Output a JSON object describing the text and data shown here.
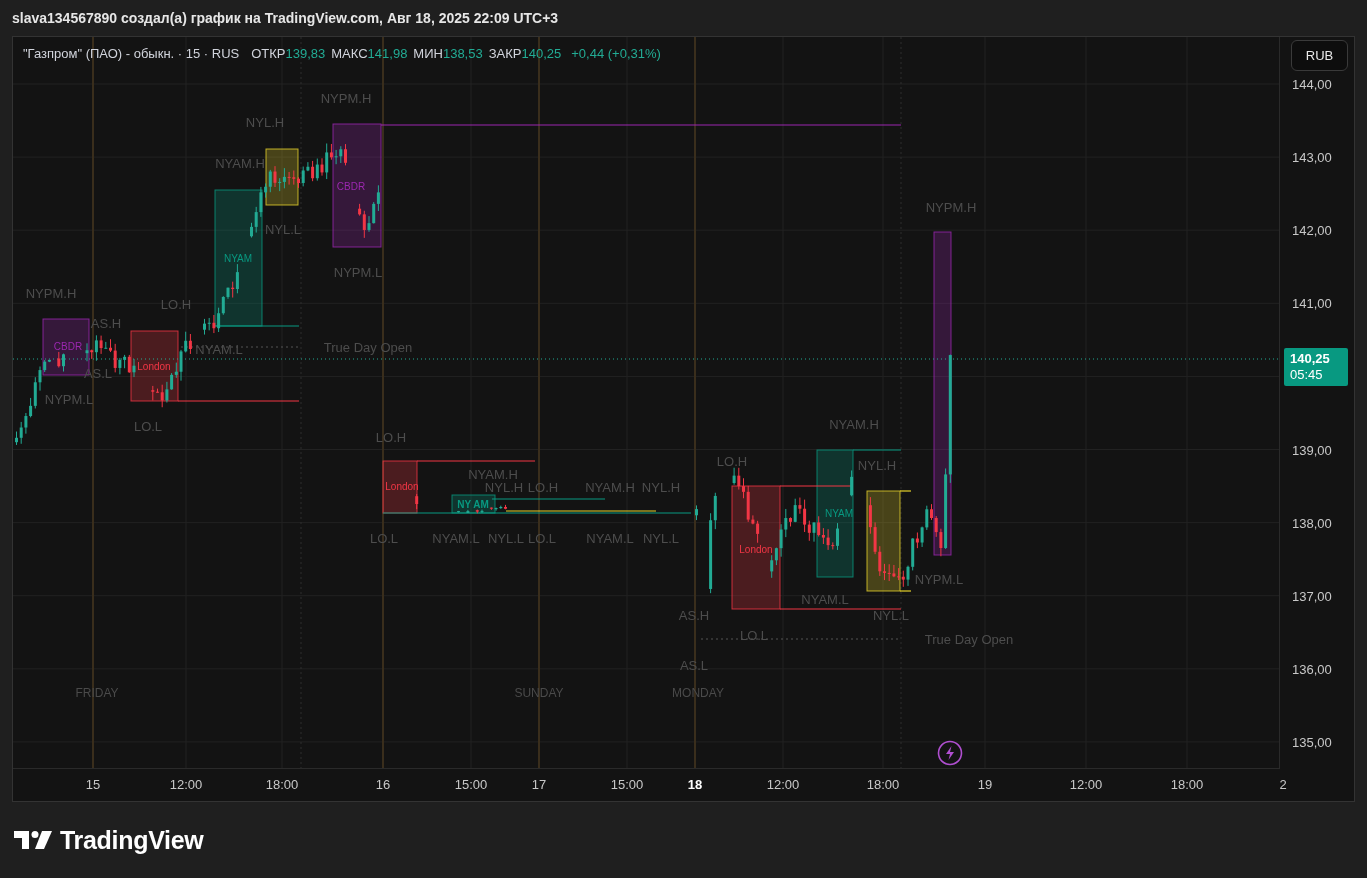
{
  "header": {
    "text": "slava134567890 создал(а) график на TradingView.com, Авг 18, 2025 22:09 UTC+3"
  },
  "legend": {
    "symbol": "\"Газпром\" (ПАО) - обыкн. · 15 · RUS",
    "fields": [
      {
        "label": "ОТКР",
        "value": "139,83"
      },
      {
        "label": "МАКС",
        "value": "141,98"
      },
      {
        "label": "МИН",
        "value": "138,53"
      },
      {
        "label": "ЗАКР",
        "value": "140,25"
      }
    ],
    "change": "+0,44 (+0,31%)"
  },
  "currency_button": "RUB",
  "price_axis": {
    "ticks": [
      "144,00",
      "143,00",
      "142,00",
      "141,00",
      "139,00",
      "138,00",
      "137,00",
      "136,00",
      "135,00"
    ],
    "last_price": "140,25",
    "countdown": "05:45"
  },
  "time_axis": [
    {
      "label": "15",
      "current": false
    },
    {
      "label": "12:00",
      "current": false
    },
    {
      "label": "18:00",
      "current": false
    },
    {
      "label": "16",
      "current": false
    },
    {
      "label": "15:00",
      "current": false
    },
    {
      "label": "17",
      "current": false
    },
    {
      "label": "15:00",
      "current": false
    },
    {
      "label": "18",
      "current": true
    },
    {
      "label": "12:00",
      "current": false
    },
    {
      "label": "18:00",
      "current": false
    },
    {
      "label": "19",
      "current": false
    },
    {
      "label": "12:00",
      "current": false
    },
    {
      "label": "18:00",
      "current": false
    },
    {
      "label": "2",
      "current": false
    }
  ],
  "chart_labels": [
    {
      "text": "NYPM.H",
      "kind": "level"
    },
    {
      "text": "NYL.H",
      "kind": "level"
    },
    {
      "text": "NYAM.H",
      "kind": "level"
    },
    {
      "text": "CBDR",
      "kind": "session",
      "color": "#9c27b0"
    },
    {
      "text": "NYPM.H",
      "kind": "level"
    },
    {
      "text": "NYL.L",
      "kind": "level"
    },
    {
      "text": "NYAM",
      "kind": "session",
      "color": "#089981"
    },
    {
      "text": "NYPM.L",
      "kind": "level"
    },
    {
      "text": "NYPM.H",
      "kind": "level"
    },
    {
      "text": "LO.H",
      "kind": "level"
    },
    {
      "text": "AS.H",
      "kind": "level"
    },
    {
      "text": "CBDR",
      "kind": "session",
      "color": "#9c27b0"
    },
    {
      "text": "NYAM.L",
      "kind": "level"
    },
    {
      "text": "True Day Open",
      "kind": "level"
    },
    {
      "text": "London",
      "kind": "session",
      "color": "#f23645"
    },
    {
      "text": "AS.L",
      "kind": "level"
    },
    {
      "text": "NYPM.L",
      "kind": "level"
    },
    {
      "text": "NYAM.H",
      "kind": "level"
    },
    {
      "text": "LO.L",
      "kind": "level"
    },
    {
      "text": "LO.H",
      "kind": "level"
    },
    {
      "text": "LO.H",
      "kind": "level"
    },
    {
      "text": "NYL.H",
      "kind": "level"
    },
    {
      "text": "NYAM.H",
      "kind": "level"
    },
    {
      "text": "London",
      "kind": "session",
      "color": "#f23645"
    },
    {
      "text": "NYL.H",
      "kind": "level"
    },
    {
      "text": "LO.H",
      "kind": "level"
    },
    {
      "text": "NYAM.H",
      "kind": "level"
    },
    {
      "text": "NYL.H",
      "kind": "level"
    },
    {
      "text": "NY AM",
      "kind": "session",
      "color": "#089981"
    },
    {
      "text": "NYAM",
      "kind": "session",
      "color": "#089981"
    },
    {
      "text": "LO.L",
      "kind": "level"
    },
    {
      "text": "NYAM.L",
      "kind": "level"
    },
    {
      "text": "NYL.L",
      "kind": "level"
    },
    {
      "text": "LO.L",
      "kind": "level"
    },
    {
      "text": "NYAM.L",
      "kind": "level"
    },
    {
      "text": "NYL.L",
      "kind": "level"
    },
    {
      "text": "London",
      "kind": "session",
      "color": "#f23645"
    },
    {
      "text": "NYPM.L",
      "kind": "level"
    },
    {
      "text": "NYAM.L",
      "kind": "level"
    },
    {
      "text": "AS.H",
      "kind": "level"
    },
    {
      "text": "NYL.L",
      "kind": "level"
    },
    {
      "text": "LO.L",
      "kind": "level"
    },
    {
      "text": "True Day Open",
      "kind": "level"
    },
    {
      "text": "AS.L",
      "kind": "level"
    },
    {
      "text": "FRIDAY",
      "kind": "day"
    },
    {
      "text": "SUNDAY",
      "kind": "day"
    },
    {
      "text": "MONDAY",
      "kind": "day"
    }
  ],
  "logo": {
    "text": "TradingView"
  }
}
